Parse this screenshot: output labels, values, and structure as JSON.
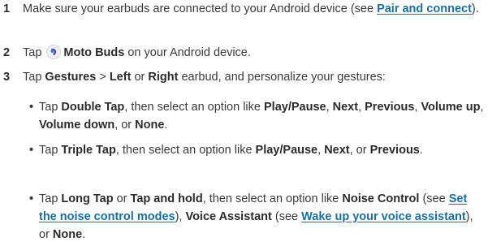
{
  "steps": [
    {
      "number": "1",
      "text_a": "Make sure your earbuds are connected to your Android device (see ",
      "link": "Pair and connect",
      "text_b": ")."
    },
    {
      "number": "2",
      "text_a": "Tap ",
      "app_icon": "moto-buds-app-icon",
      "bold": "Moto Buds",
      "text_b": " on your Android device."
    },
    {
      "number": "3",
      "text_a": "Tap ",
      "b1": "Gestures",
      "text_b": " > ",
      "b2": "Left",
      "text_c": " or ",
      "b3": "Right",
      "text_d": " earbud, and personalize your gestures:"
    }
  ],
  "bullets": [
    {
      "t1": "Tap ",
      "b1": "Double Tap",
      "t2": ", then select an option like ",
      "b2": "Play/Pause",
      "t3": ", ",
      "b3": "Next",
      "t4": ", ",
      "b4": "Previous",
      "t5": ", ",
      "b5": "Volume up",
      "t6": ", ",
      "b6": "Volume down",
      "t7": ", or ",
      "b7": "None",
      "t8": "."
    },
    {
      "t1": "Tap ",
      "b1": "Triple Tap",
      "t2": ", then select an option like ",
      "b2": "Play/Pause",
      "t3": ", ",
      "b3": "Next",
      "t4": ", or ",
      "b4": "Previous",
      "t5": "."
    },
    {
      "t1": "Tap ",
      "b1": "Long Tap",
      "t2": " or ",
      "b2": "Tap and hold",
      "t3": ", then select an option like ",
      "b3": "Noise Control",
      "t4": " (see ",
      "l1": "Set the noise control modes",
      "t5": "), ",
      "b4": "Voice Assistant",
      "t6": " (see ",
      "l2": "Wake up your voice assistant",
      "t7": "), or ",
      "b5": "None",
      "t8": "."
    }
  ],
  "colors": {
    "text": "#3a3a3a",
    "link": "#1b6f9a"
  }
}
